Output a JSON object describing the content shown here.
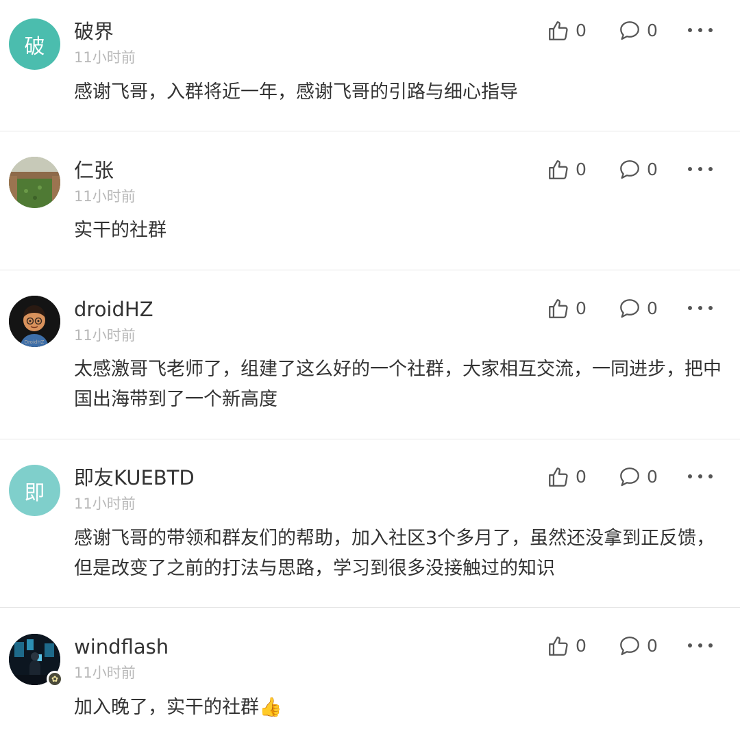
{
  "comments": [
    {
      "avatar_text": "破",
      "avatar_color": "#4bbdae",
      "name": "破界",
      "time": "11小时前",
      "content": "感谢飞哥，入群将近一年，感谢飞哥的引路与细心指导",
      "likes": "0",
      "replies": "0"
    },
    {
      "avatar_text": "",
      "avatar_icon": "farm-photo-avatar",
      "name": "仁张",
      "time": "11小时前",
      "content": "实干的社群",
      "likes": "0",
      "replies": "0"
    },
    {
      "avatar_text": "",
      "avatar_icon": "cartoon-boy-avatar",
      "avatar_caption": "DroidHZ",
      "name": "droidHZ",
      "time": "11小时前",
      "content": "太感激哥飞老师了，组建了这么好的一个社群，大家相互交流，一同进步，把中国出海带到了一个新高度",
      "likes": "0",
      "replies": "0"
    },
    {
      "avatar_text": "即",
      "avatar_color": "#7fcfcb",
      "name": "即友KUEBTD",
      "time": "11小时前",
      "content": "感谢飞哥的带领和群友们的帮助，加入社区3个多月了，虽然还没拿到正反馈，但是改变了之前的打法与思路，学习到很多没接触过的知识",
      "likes": "0",
      "replies": "0"
    },
    {
      "avatar_text": "",
      "avatar_icon": "dark-scene-avatar",
      "name": "windflash",
      "time": "11小时前",
      "content": "加入晚了，实干的社群👍",
      "likes": "0",
      "replies": "0",
      "badge_icon": "flower-badge-icon"
    }
  ],
  "icons": {
    "like": "thumbs-up-icon",
    "reply": "speech-bubble-icon",
    "more": "more-dots-icon"
  },
  "colors": {
    "divider": "#e6e6e6",
    "time": "#b8b8b8",
    "text": "#333333"
  }
}
